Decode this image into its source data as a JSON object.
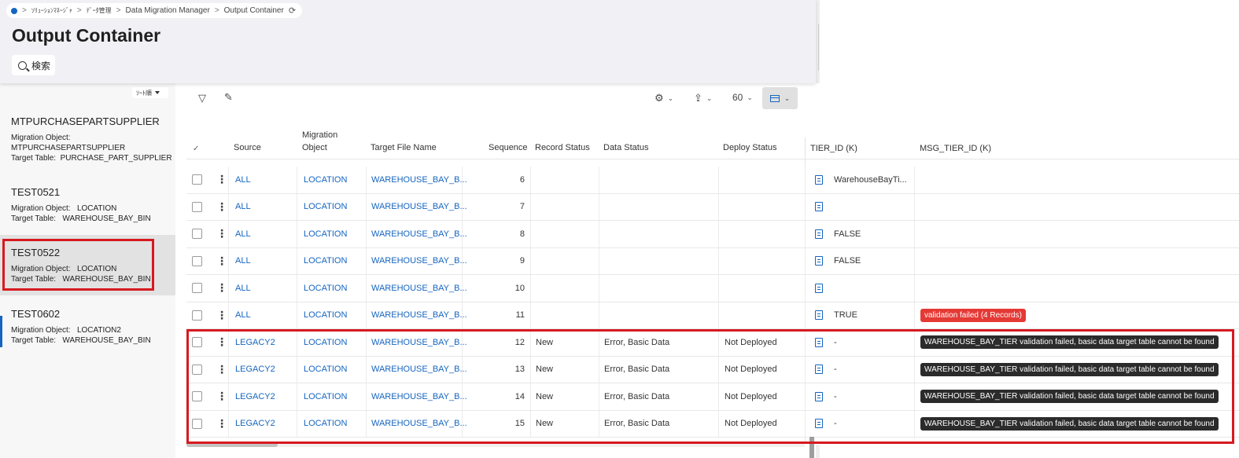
{
  "breadcrumb": {
    "items": [
      "ｿﾘｭｰｼｮﾝﾏﾈｰｼﾞｬ",
      "ﾃﾞｰﾀ管理",
      "Data Migration Manager",
      "Output Container"
    ],
    "separator": ">"
  },
  "page": {
    "title": "Output Container",
    "search_label": "検索"
  },
  "sidebar": {
    "sort_label": "ｿｰﾄ順",
    "items": [
      {
        "title": "MTPURCHASEPARTSUPPLIER",
        "migration_object_label": "Migration Object:",
        "migration_object": "MTPURCHASEPARTSUPPLIER",
        "target_table_label": "Target Table:",
        "target_table": "PURCHASE_PART_SUPPLIER"
      },
      {
        "title": "TEST0521",
        "migration_object_label": "Migration Object:",
        "migration_object": "LOCATION",
        "target_table_label": "Target Table:",
        "target_table": "WAREHOUSE_BAY_BIN"
      },
      {
        "title": "TEST0522",
        "migration_object_label": "Migration Object:",
        "migration_object": "LOCATION",
        "target_table_label": "Target Table:",
        "target_table": "WAREHOUSE_BAY_BIN"
      },
      {
        "title": "TEST0602",
        "migration_object_label": "Migration Object:",
        "migration_object": "LOCATION2",
        "target_table_label": "Target Table:",
        "target_table": "WAREHOUSE_BAY_BIN"
      }
    ]
  },
  "toolbar": {
    "page_size": "60"
  },
  "table": {
    "columns": {
      "source": "Source",
      "migration_object_1": "Migration",
      "migration_object_2": "Object",
      "target_file": "Target File Name",
      "sequence": "Sequence",
      "record_status": "Record Status",
      "data_status": "Data Status",
      "deploy_status": "Deploy Status",
      "tier_id": "TIER_ID (K)",
      "msg_tier_id": "MSG_TIER_ID (K)"
    },
    "rows": [
      {
        "source": "ALL",
        "migration_object": "LOCATION",
        "target_file": "WAREHOUSE_BAY_B...",
        "sequence": "6",
        "record_status": "",
        "data_status": "",
        "deploy_status": "",
        "tier_id": "WarehouseBayTi...",
        "msg": ""
      },
      {
        "source": "ALL",
        "migration_object": "LOCATION",
        "target_file": "WAREHOUSE_BAY_B...",
        "sequence": "7",
        "record_status": "",
        "data_status": "",
        "deploy_status": "",
        "tier_id": "",
        "msg": ""
      },
      {
        "source": "ALL",
        "migration_object": "LOCATION",
        "target_file": "WAREHOUSE_BAY_B...",
        "sequence": "8",
        "record_status": "",
        "data_status": "",
        "deploy_status": "",
        "tier_id": "FALSE",
        "msg": ""
      },
      {
        "source": "ALL",
        "migration_object": "LOCATION",
        "target_file": "WAREHOUSE_BAY_B...",
        "sequence": "9",
        "record_status": "",
        "data_status": "",
        "deploy_status": "",
        "tier_id": "FALSE",
        "msg": ""
      },
      {
        "source": "ALL",
        "migration_object": "LOCATION",
        "target_file": "WAREHOUSE_BAY_B...",
        "sequence": "10",
        "record_status": "",
        "data_status": "",
        "deploy_status": "",
        "tier_id": "",
        "msg": ""
      },
      {
        "source": "ALL",
        "migration_object": "LOCATION",
        "target_file": "WAREHOUSE_BAY_B...",
        "sequence": "11",
        "record_status": "",
        "data_status": "",
        "deploy_status": "",
        "tier_id": "TRUE",
        "msg": "validation failed (4 Records)"
      },
      {
        "source": "LEGACY2",
        "migration_object": "LOCATION",
        "target_file": "WAREHOUSE_BAY_B...",
        "sequence": "12",
        "record_status": "New",
        "data_status": "Error, Basic Data",
        "deploy_status": "Not Deployed",
        "tier_id": "-",
        "msg": "WAREHOUSE_BAY_TIER validation failed, basic data target table cannot be found"
      },
      {
        "source": "LEGACY2",
        "migration_object": "LOCATION",
        "target_file": "WAREHOUSE_BAY_B...",
        "sequence": "13",
        "record_status": "New",
        "data_status": "Error, Basic Data",
        "deploy_status": "Not Deployed",
        "tier_id": "-",
        "msg": "WAREHOUSE_BAY_TIER validation failed, basic data target table cannot be found"
      },
      {
        "source": "LEGACY2",
        "migration_object": "LOCATION",
        "target_file": "WAREHOUSE_BAY_B...",
        "sequence": "14",
        "record_status": "New",
        "data_status": "Error, Basic Data",
        "deploy_status": "Not Deployed",
        "tier_id": "-",
        "msg": "WAREHOUSE_BAY_TIER validation failed, basic data target table cannot be found"
      },
      {
        "source": "LEGACY2",
        "migration_object": "LOCATION",
        "target_file": "WAREHOUSE_BAY_B...",
        "sequence": "15",
        "record_status": "New",
        "data_status": "Error, Basic Data",
        "deploy_status": "Not Deployed",
        "tier_id": "-",
        "msg": "WAREHOUSE_BAY_TIER validation failed, basic data target table cannot be found"
      }
    ]
  },
  "colors": {
    "accent": "#1565c0",
    "highlight": "#d71920",
    "error_badge": "#e53935",
    "message_badge": "#2b2b2b"
  }
}
